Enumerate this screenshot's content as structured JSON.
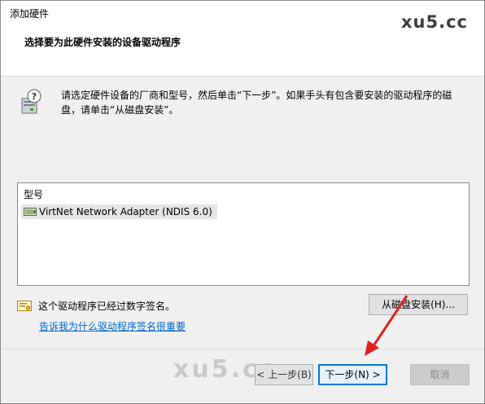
{
  "window": {
    "title": "添加硬件",
    "watermark": "xu5.cc",
    "subtitle": "选择要为此硬件安装的设备驱动程序"
  },
  "instructions": {
    "text": "请选定硬件设备的厂商和型号，然后单击“下一步”。如果手头有包含要安装的驱动程序的磁盘，请单击“从磁盘安装”。",
    "icon": "hardware-question-icon"
  },
  "model_list": {
    "header": "型号",
    "items": [
      {
        "label": "VirtNet Network Adapter (NDIS 6.0)",
        "icon": "network-adapter-icon",
        "selected": true
      }
    ]
  },
  "signature": {
    "icon": "certificate-icon",
    "status": "这个驱动程序已经过数字签名。",
    "link": "告诉我为什么驱动程序签名很重要"
  },
  "buttons": {
    "have_disk": "从磁盘安装(H)...",
    "back": "< 上一步(B)",
    "next": "下一步(N) >",
    "cancel": "取消"
  },
  "overlay": {
    "watermark_bottom": "xu5.cc",
    "arrow_color": "#e02020"
  }
}
